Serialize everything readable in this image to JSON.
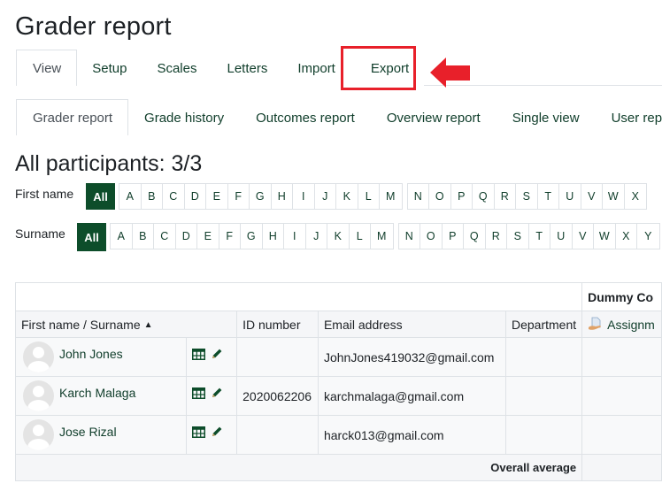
{
  "page": {
    "title": "Grader report"
  },
  "primary_tabs": [
    {
      "label": "View",
      "active": true
    },
    {
      "label": "Setup",
      "active": false
    },
    {
      "label": "Scales",
      "active": false
    },
    {
      "label": "Letters",
      "active": false
    },
    {
      "label": "Import",
      "active": false
    },
    {
      "label": "Export",
      "active": false,
      "highlighted": true
    }
  ],
  "secondary_tabs": [
    {
      "label": "Grader report",
      "active": true
    },
    {
      "label": "Grade history",
      "active": false
    },
    {
      "label": "Outcomes report",
      "active": false
    },
    {
      "label": "Overview report",
      "active": false
    },
    {
      "label": "Single view",
      "active": false
    },
    {
      "label": "User report",
      "active": false
    }
  ],
  "annotation": {
    "highlight_color": "#e8202a",
    "arrow_icon": "left-arrow-icon"
  },
  "participants": {
    "heading": "All participants: 3/3"
  },
  "initials_filter": {
    "first_name_label": "First name",
    "surname_label": "Surname",
    "all_label": "All",
    "group1": [
      "A",
      "B",
      "C",
      "D",
      "E",
      "F",
      "G",
      "H",
      "I",
      "J",
      "K",
      "L",
      "M"
    ],
    "group2_first": [
      "N",
      "O",
      "P",
      "Q",
      "R",
      "S",
      "T",
      "U",
      "V",
      "W",
      "X"
    ],
    "group2_last": [
      "N",
      "O",
      "P",
      "Q",
      "R",
      "S",
      "T",
      "U",
      "V",
      "W",
      "X",
      "Y"
    ],
    "active_color": "#0d4d2a"
  },
  "table": {
    "course_header": "Dummy Co",
    "columns": {
      "name": "First name / Surname",
      "id_number": "ID number",
      "email": "Email address",
      "department": "Department",
      "assignment": "Assignm"
    },
    "sort_indicator": "sort-ascending-icon",
    "rows": [
      {
        "name": "John Jones",
        "id_number": "",
        "email": "JohnJones419032@gmail.com",
        "department": ""
      },
      {
        "name": "Karch Malaga",
        "id_number": "2020062206",
        "email": "karchmalaga@gmail.com",
        "department": ""
      },
      {
        "name": "Jose Rizal",
        "id_number": "",
        "email": "harck013@gmail.com",
        "department": ""
      }
    ],
    "overall_average_label": "Overall average"
  }
}
